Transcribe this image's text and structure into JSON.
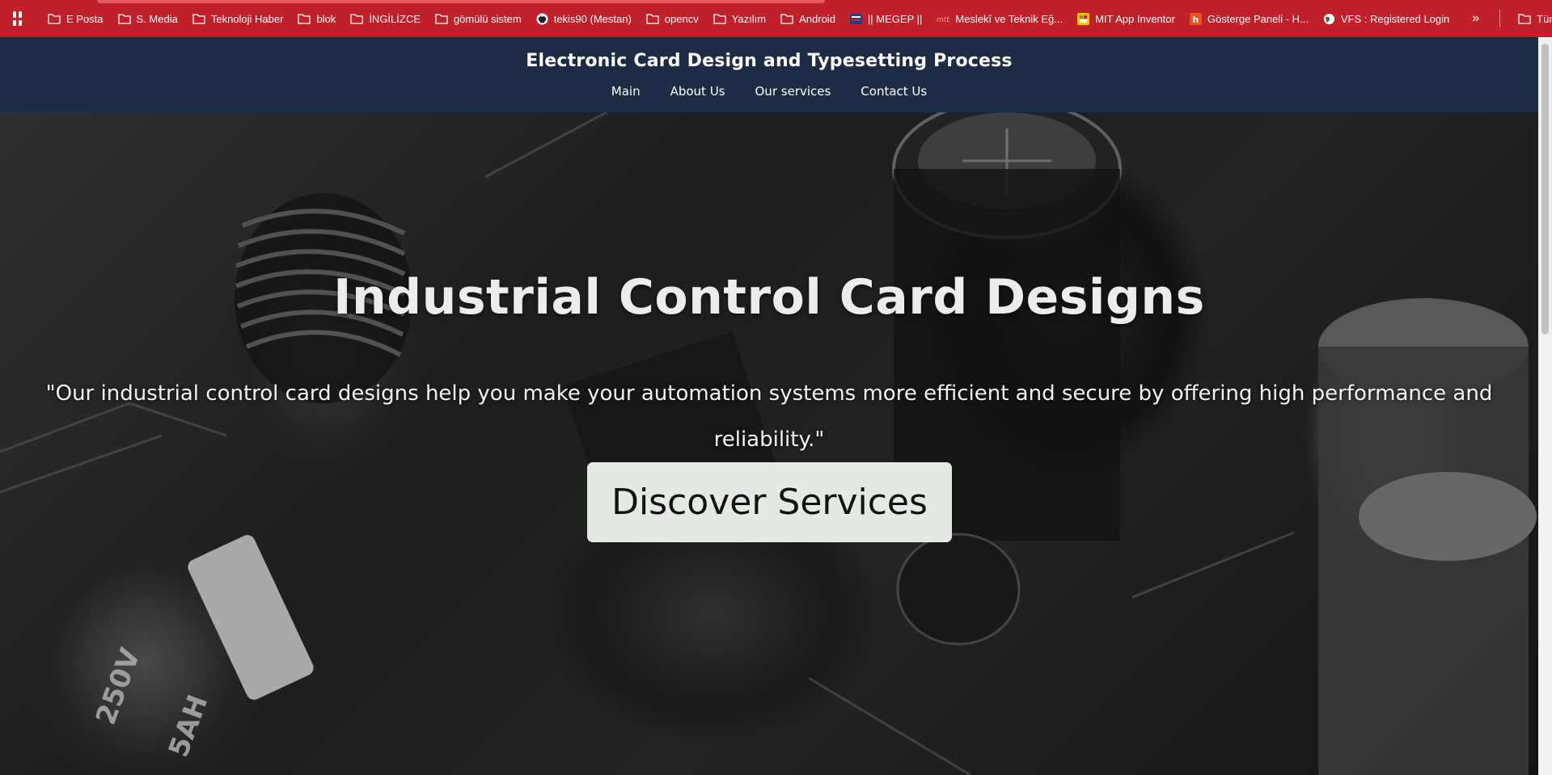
{
  "bookmarks": {
    "items": [
      {
        "label": "E Posta",
        "icon": "folder-icon"
      },
      {
        "label": "S. Media",
        "icon": "folder-icon"
      },
      {
        "label": "Teknoloji Haber",
        "icon": "folder-icon"
      },
      {
        "label": "blok",
        "icon": "folder-icon"
      },
      {
        "label": "İNGİLİZCE",
        "icon": "folder-icon"
      },
      {
        "label": "gömülü sistem",
        "icon": "folder-icon"
      },
      {
        "label": "tekis90 (Mestan)",
        "icon": "github-icon"
      },
      {
        "label": "opencv",
        "icon": "folder-icon"
      },
      {
        "label": "Yazılım",
        "icon": "folder-icon"
      },
      {
        "label": "Android",
        "icon": "folder-icon"
      },
      {
        "label": "|| MEGEP ||",
        "icon": "megep-icon"
      },
      {
        "label": "Meslekî ve Teknik Eğ...",
        "icon": "meb-icon"
      },
      {
        "label": "MIT App Inventor",
        "icon": "mit-app-inventor-icon"
      },
      {
        "label": "Gösterge Paneli - H...",
        "icon": "hostinger-icon"
      },
      {
        "label": "VFS : Registered Login",
        "icon": "globe-icon"
      }
    ],
    "more_label": "»",
    "all_bookmarks_label": "Tüm Yer İşaretleri",
    "bar_color": "#c0202a"
  },
  "header": {
    "title": "Electronic Card Design and Typesetting Process",
    "nav": [
      "Main",
      "About Us",
      "Our services",
      "Contact Us"
    ],
    "background_color": "#1d2b45"
  },
  "hero": {
    "title": "Industrial Control Card Designs",
    "quote": "\"Our industrial control card designs help you make your automation systems more efficient and secure by offering high performance and reliability.\"",
    "button_label": "Discover Services",
    "button_color": "#e4e9e3"
  }
}
